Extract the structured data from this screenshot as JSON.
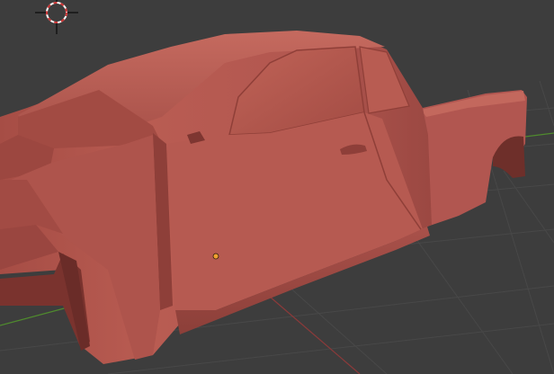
{
  "viewport": {
    "type": "3d-viewport",
    "shading": "solid",
    "colors": {
      "background": "#3d3d3d",
      "grid": "#4a4a4a",
      "axis_x": "#8b3a3a",
      "axis_y": "#4f8a2e",
      "model": "#b4574e",
      "model_shadow": "#8a3e38",
      "model_highlight": "#c86a60",
      "cursor_ring": "#ffffff",
      "cursor_dash": "#cc3333",
      "origin_point": "#f0a030"
    },
    "icons": {
      "cursor": "3d-cursor-icon",
      "origin": "object-origin-icon"
    },
    "object": {
      "kind": "pickup-truck-body-mesh",
      "selected": false
    }
  }
}
